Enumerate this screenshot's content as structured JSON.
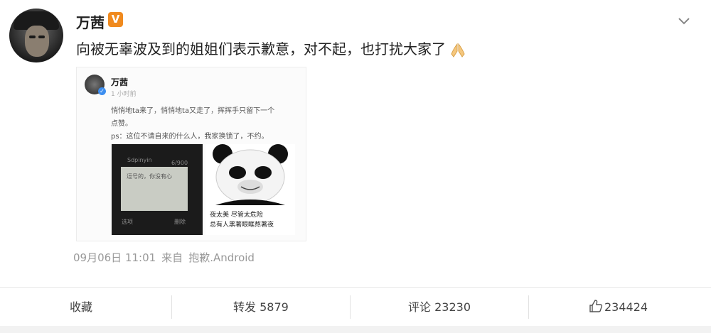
{
  "post": {
    "author": "万茜",
    "verified_badge": "V",
    "text": "向被无辜波及到的姐姐们表示歉意，对不起，也打扰大家了",
    "text_emoji": "folded-hands",
    "timestamp": "09月06日 11:01",
    "source_prefix": "来自",
    "source": "抱歉.Android"
  },
  "embedded": {
    "author": "万茜",
    "time": "1 小时前",
    "line1": "悄悄地ta来了，悄悄地ta又走了，挥挥手只留下一个",
    "line2": "点赞。",
    "line3": "ps：这位不请自来的什么人，我家换锁了，不约。",
    "phone_brand": "Sdpinyin",
    "phone_count": "6/900",
    "phone_text": "逗号的，你没有心",
    "phone_left": "选项",
    "phone_right": "删除",
    "panda_caption1": "夜太美 尽管太危险",
    "panda_caption2": "总有人黑著眼眶熬著夜"
  },
  "actions": {
    "favorite": "收藏",
    "repost_label": "转发",
    "repost_count": "5879",
    "comment_label": "评论",
    "comment_count": "23230",
    "like_count": "234424"
  },
  "colors": {
    "badge": "#f08a1e",
    "meta_text": "#999999",
    "verified_blue": "#3c8ef0"
  }
}
